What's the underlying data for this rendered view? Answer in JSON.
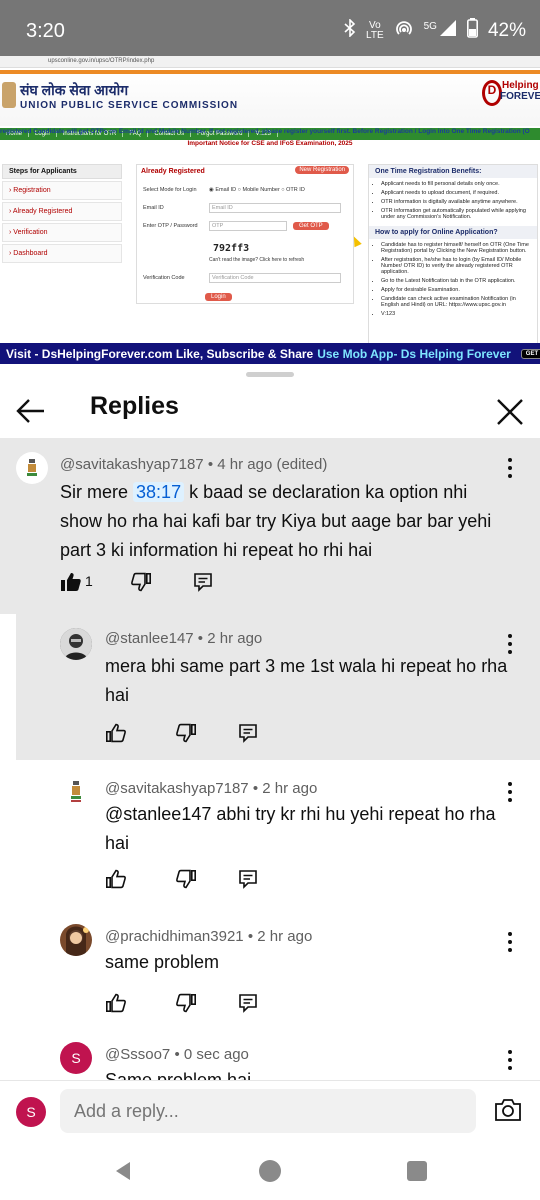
{
  "status_bar": {
    "time": "3:20",
    "network_volte_line1": "Vo",
    "network_volte_line2": "LTE",
    "network_5g": "5G",
    "battery": "42%"
  },
  "video": {
    "url": "upsconline.gov.in/upsc/OTRP/index.php",
    "hindi_title": "संघ लोक सेवा आयोग",
    "english_title": "UNION PUBLIC SERVICE COMMISSION",
    "logo_line1": "Helping",
    "logo_line2": "FOREVER",
    "nav": [
      "Home",
      "Login",
      "Instructions for OTR",
      "FAQ",
      "Contact Us",
      "Forgot Password",
      "V:123"
    ],
    "marquee": "registered Candidate will get OTPs on Email Id and Mobile Number. If not registered, please register yourself first. Before Registration / Login into One Time Registration (O",
    "notice": "Important Notice for CSE and IFoS Examination, 2025",
    "steps_title": "Steps for Applicants",
    "steps": [
      "Registration",
      "Already Registered",
      "Verification",
      "Dashboard"
    ],
    "form_title": "Already Registered",
    "new_registration": "New Registration",
    "mode_label": "Select Mode for Login",
    "mode_options": "◉ Email ID  ○ Mobile Number  ○ OTR ID",
    "email_label": "Email ID",
    "email_placeholder": "Email ID",
    "otp_label": "Enter OTP / Password",
    "otp_placeholder": "OTP",
    "get_otp": "Get OTP",
    "captcha": "792ff3",
    "captcha_help": "Can't read the image? Click here to refresh",
    "verification_label": "Verification Code",
    "verification_placeholder": "Verification Code",
    "login": "Login",
    "benefits_title": "One Time Registration Benefits:",
    "benefits": [
      "Applicant needs to fill personal details only once.",
      "Applicant needs to upload document, if required.",
      "OTR information is digitally available anytime anywhere.",
      "OTR information get automatically populated while applying under any Commission's Notification."
    ],
    "howto_title": "How to apply for Online Application?",
    "howto": [
      "Candidate has to register himself/ herself on OTR (One Time Registration) portal by Clicking the New Registration button.",
      "After registration, he/she has to login (by Email ID/ Mobile Number/ OTR ID) to verify the already registered OTR application.",
      "Go to the Latest Notification tab in the OTR application.",
      "Apply for desirable Examination.",
      "Candidate can check active examination Notification (in English and Hindi) on URL: https://www.upsc.gov.in",
      "V:123"
    ],
    "ticker_text": "Visit - DsHelpingForever.com   Like, Subscribe & Share",
    "ticker_highlight": "Use Mob App- Ds Helping Forever",
    "google_play": "GET IT ON Google Play"
  },
  "panel": {
    "title": "Replies",
    "comments": [
      {
        "author": "@savitakashyap7187",
        "time": "• 4 hr ago (edited)",
        "timestamp_link": "38:17",
        "text_before": "Sir mere",
        "text_after": "k baad se declaration ka option nhi show ho rha hai kafi bar try Kiya but aage bar bar yehi part 3 ki information hi repeat ho rhi hai",
        "likes": "1"
      },
      {
        "author": "@stanlee147",
        "time": "• 2 hr ago",
        "text": "mera bhi same part 3 me 1st wala hi repeat ho rha hai"
      },
      {
        "author": "@savitakashyap7187",
        "time": "• 2 hr ago",
        "text": "@stanlee147  abhi try kr rhi hu yehi repeat ho rha hai"
      },
      {
        "author": "@prachidhiman3921",
        "time": "• 2 hr ago",
        "text": "same problem"
      },
      {
        "author": "@Sssoo7",
        "time": "• 0 sec ago",
        "avatar_letter": "S",
        "text": "Same problem hai"
      }
    ]
  },
  "reply_bar": {
    "avatar_letter": "S",
    "placeholder": "Add a reply..."
  },
  "colors": {
    "link": "#065fd4",
    "highlight": "#e8e8e8",
    "avatar_red": "#c0134f",
    "upsc_green": "#2e8b2e"
  }
}
